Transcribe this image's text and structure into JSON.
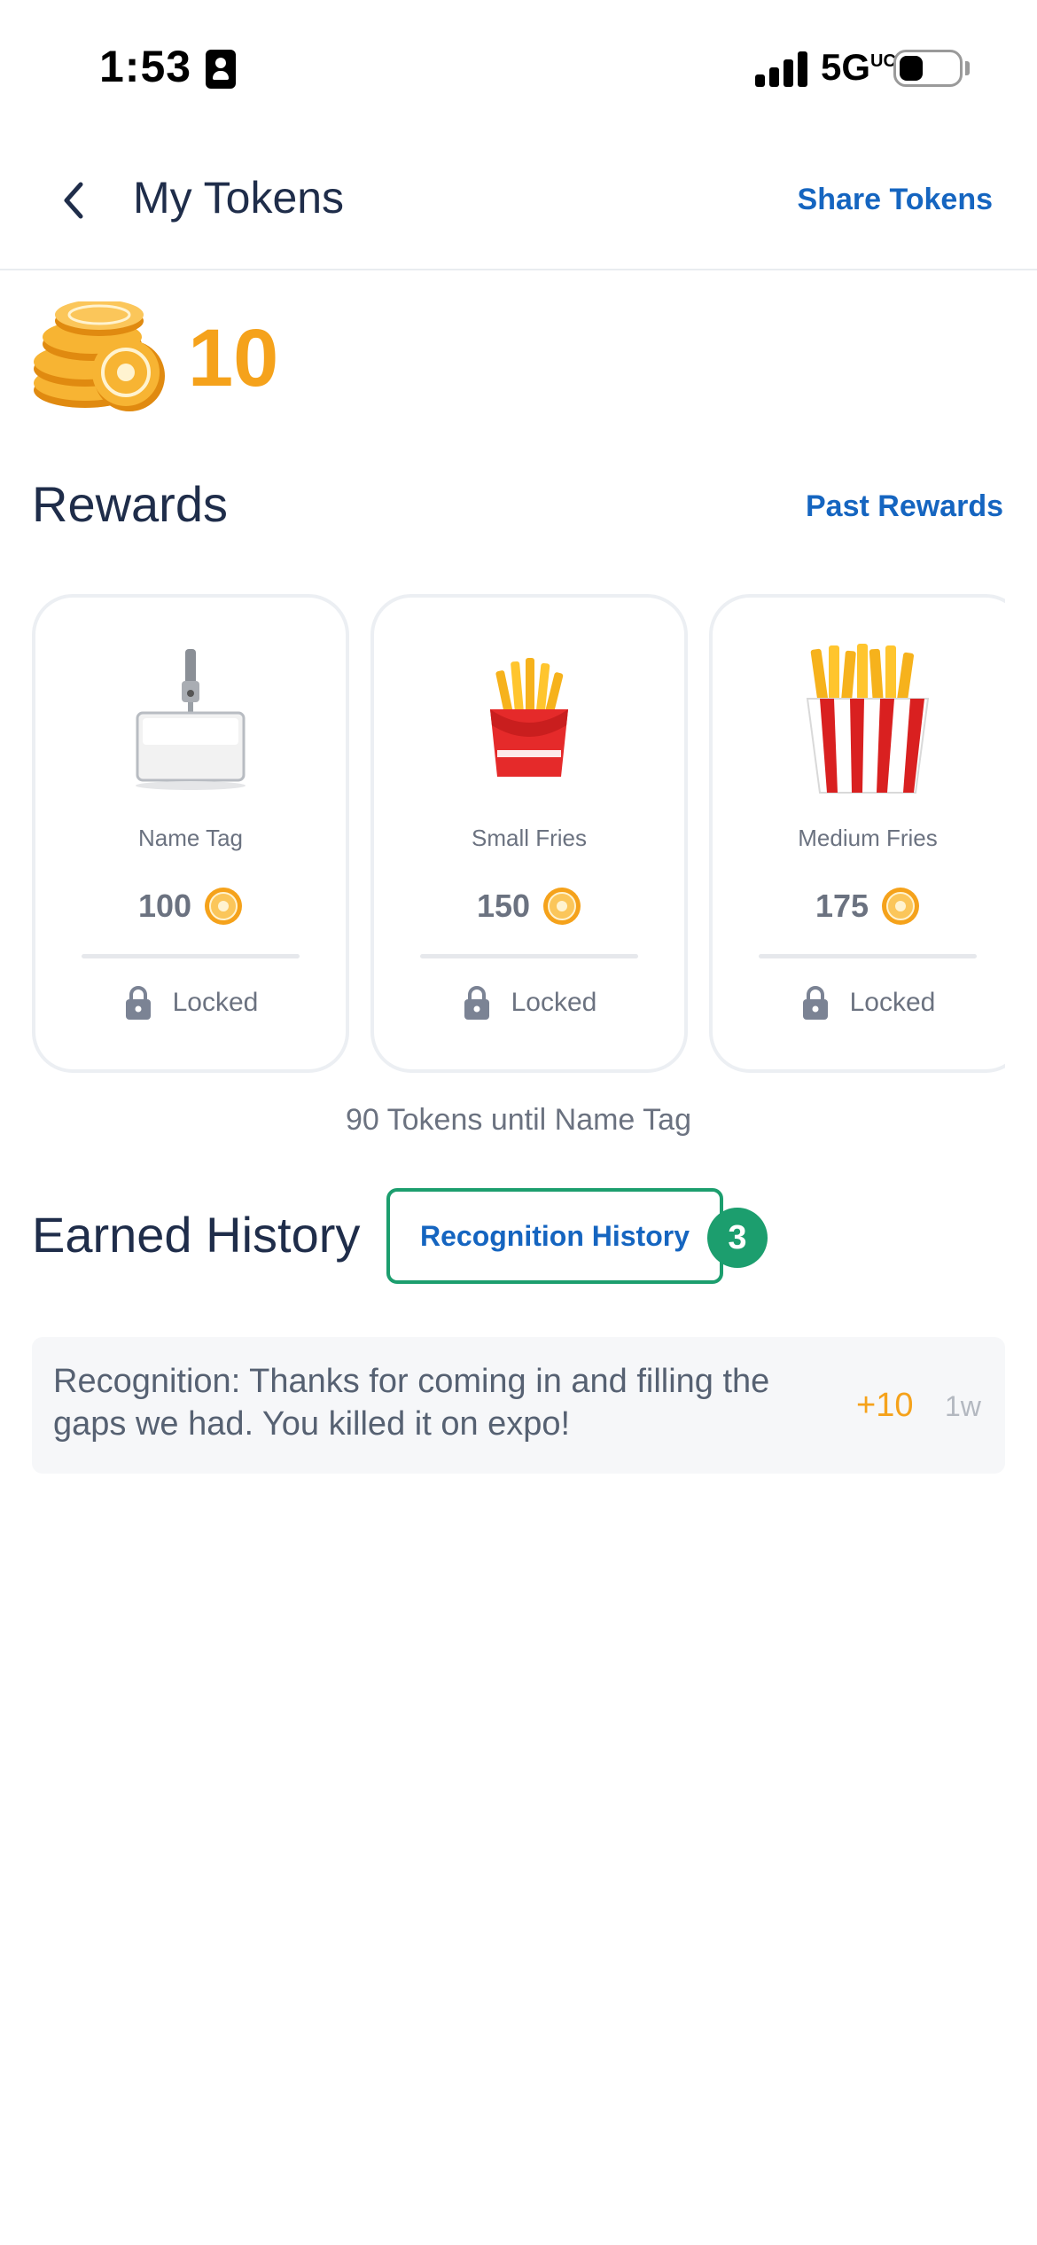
{
  "status_bar": {
    "time": "1:53",
    "network": "5G",
    "network_suffix": "UC"
  },
  "header": {
    "title": "My Tokens",
    "share_label": "Share Tokens"
  },
  "balance": {
    "tokens": "10"
  },
  "rewards": {
    "title": "Rewards",
    "past_label": "Past Rewards",
    "items": [
      {
        "name": "Name Tag",
        "cost": "100",
        "status": "Locked",
        "icon": "name-tag-icon"
      },
      {
        "name": "Small Fries",
        "cost": "150",
        "status": "Locked",
        "icon": "small-fries-icon"
      },
      {
        "name": "Medium Fries",
        "cost": "175",
        "status": "Locked",
        "icon": "medium-fries-icon"
      }
    ],
    "progress_text": "90 Tokens until Name Tag"
  },
  "earned_history": {
    "title": "Earned History",
    "tab_label": "Recognition History",
    "tab_badge": "3",
    "items": [
      {
        "text": "Recognition:  Thanks for coming in and filling the gaps we had. You killed it on expo!",
        "points": "+10",
        "time": "1w"
      }
    ]
  },
  "colors": {
    "accent_blue": "#1565c0",
    "token_orange": "#f5a21b",
    "badge_green": "#1c9e6e",
    "title_navy": "#1f2d4a"
  }
}
